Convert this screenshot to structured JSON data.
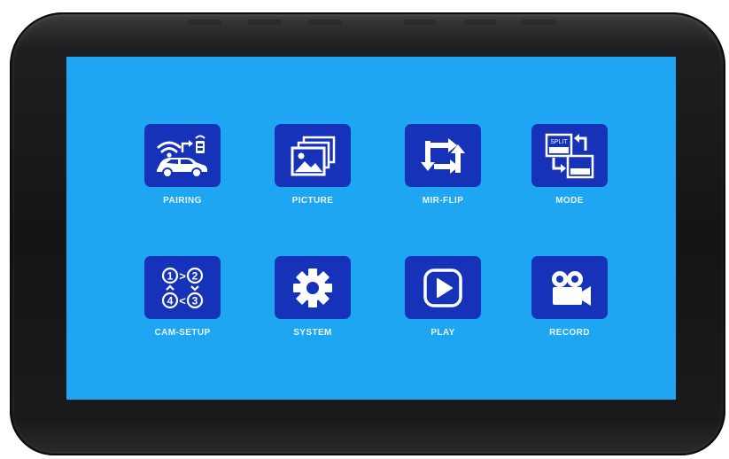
{
  "menu": {
    "items": [
      {
        "label": "PAIRING",
        "icon": "pairing-icon"
      },
      {
        "label": "PICTURE",
        "icon": "picture-icon"
      },
      {
        "label": "MIR-FLIP",
        "icon": "mirror-flip-icon"
      },
      {
        "label": "MODE",
        "icon": "split-mode-icon"
      },
      {
        "label": "CAM-SETUP",
        "icon": "camera-setup-icon"
      },
      {
        "label": "SYSTEM",
        "icon": "gear-icon"
      },
      {
        "label": "PLAY",
        "icon": "play-icon"
      },
      {
        "label": "RECORD",
        "icon": "video-camera-icon"
      }
    ],
    "mode_icon_text": "SPLIT",
    "cam_setup_numbers": [
      "1",
      "2",
      "4",
      "3"
    ]
  },
  "colors": {
    "screen_background": "#1ea6f2",
    "tile_background": "#1532b8",
    "label_text": "#e8f4ff",
    "bezel": "#141416"
  }
}
